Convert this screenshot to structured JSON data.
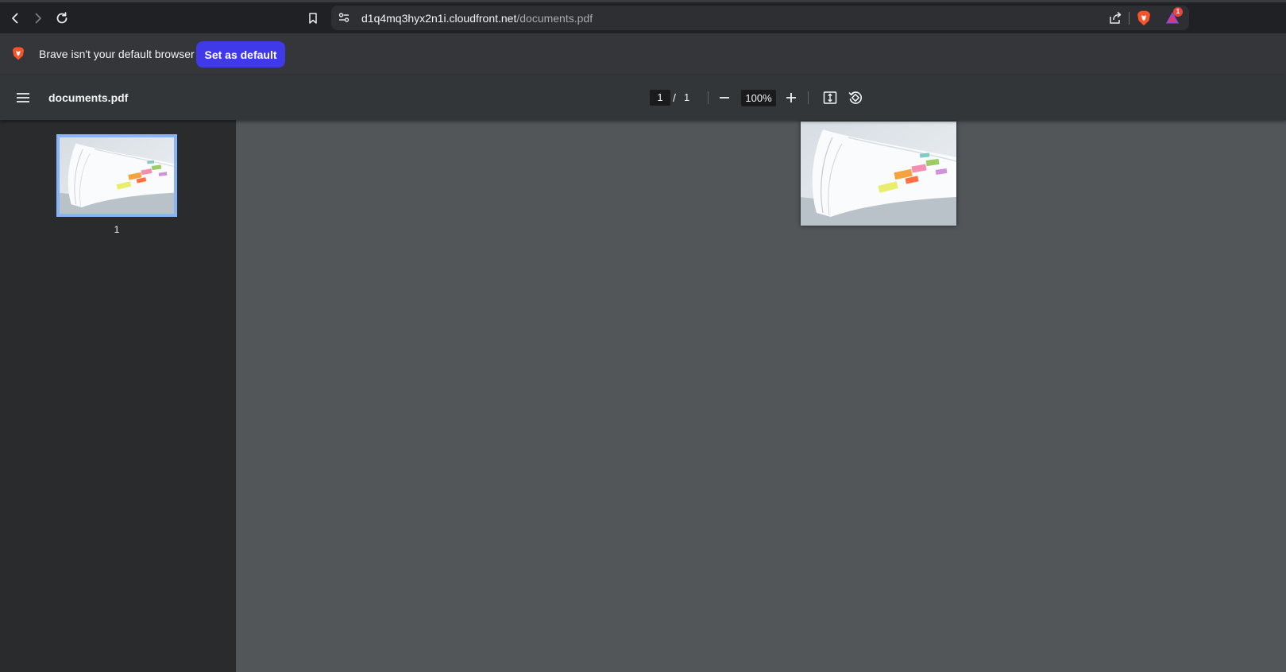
{
  "browser": {
    "url_host": "d1q4mq3hyx2n1i.cloudfront.net",
    "url_path": "/documents.pdf",
    "notification_count": "1",
    "icons": [
      "back-icon",
      "forward-icon",
      "reload-icon",
      "bookmark-icon",
      "site-settings-icon",
      "share-icon",
      "brave-shields-icon",
      "brave-rewards-icon"
    ]
  },
  "infobar": {
    "message": "Brave isn't your default browser",
    "button_label": "Set as default"
  },
  "pdf_toolbar": {
    "title": "documents.pdf",
    "current_page": "1",
    "separator": "/",
    "total_pages": "1",
    "zoom": "100%",
    "icons": [
      "menu-icon",
      "zoom-out-icon",
      "zoom-in-icon",
      "fit-page-icon",
      "rotate-icon"
    ]
  },
  "sidebar": {
    "thumbnails": [
      {
        "page_label": "1",
        "selected": true
      }
    ],
    "selection_color": "#8ab4f8"
  },
  "colors": {
    "accent_button": "#3f39e8",
    "viewer_bg": "#525659",
    "sidebar_bg": "#292b2d",
    "toolbar_bg": "#323639"
  }
}
